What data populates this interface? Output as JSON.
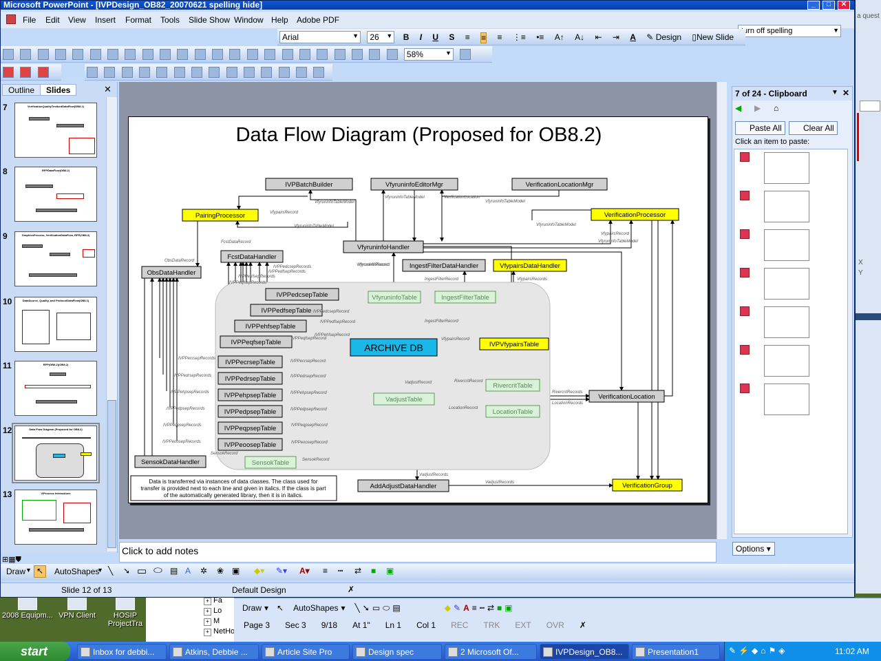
{
  "window": {
    "title": "Microsoft PowerPoint - [IVPDesign_OB82_20070621 spelling hide]"
  },
  "menu": [
    "File",
    "Edit",
    "View",
    "Insert",
    "Format",
    "Tools",
    "Slide Show",
    "Window",
    "Help",
    "Adobe PDF"
  ],
  "ask": "turn off spelling",
  "formatting": {
    "font": "Arial",
    "size": "26",
    "design_label": "Design",
    "newslide_label": "New Slide"
  },
  "standard": {
    "zoom": "58%"
  },
  "left_pane": {
    "tab_outline": "Outline",
    "tab_slides": "Slides",
    "slides": [
      {
        "num": "7",
        "title": "VerificationQualityTestbedDataFlow(OB8.1)"
      },
      {
        "num": "8",
        "title": "RFPDataFlow(OB8.2)"
      },
      {
        "num": "9",
        "title": "GraphicsProcess, VerificationDataFlow, RFP(OB8.2)"
      },
      {
        "num": "10",
        "title": "DataSource, Quality, and ProtocolDataFlow(OB8.1)"
      },
      {
        "num": "11",
        "title": "RFP(OB8.2)(OB8.2)"
      },
      {
        "num": "12",
        "title": "Data Flow Diagram (Proposed for OB8.2)",
        "selected": true
      },
      {
        "num": "13",
        "title": "VIProcess Interactions"
      }
    ]
  },
  "slide": {
    "title": "Data Flow Diagram (Proposed for OB8.2)",
    "note": [
      "Data is transferred via instances of data classes.  The class used for",
      "transfer is provided next to each line and given in italics.  If the class is part",
      "of the automatically generated library, then it is in italics."
    ],
    "db": "ARCHIVE DB",
    "boxes": [
      {
        "label": "IVPBatchBuilder",
        "style": "gray"
      },
      {
        "label": "VfyruninfoEditorMgr",
        "style": "gray"
      },
      {
        "label": "VerificationLocationMgr",
        "style": "gray"
      },
      {
        "label": "PairingProcessor",
        "style": "yellow"
      },
      {
        "label": "VerificationProcessor",
        "style": "yellow"
      },
      {
        "label": "VfyruninfoHandler",
        "style": "gray"
      },
      {
        "label": "FcstDataHandler",
        "style": "gray"
      },
      {
        "label": "ObsDataHandler",
        "style": "gray"
      },
      {
        "label": "IngestFilterDataHandler",
        "style": "gray"
      },
      {
        "label": "VfypairsDataHandler",
        "style": "yellow"
      },
      {
        "label": "VfyruninfoTable",
        "style": "green"
      },
      {
        "label": "IngestFilterTable",
        "style": "green"
      },
      {
        "label": "IVPPedcsepTable",
        "style": "gray"
      },
      {
        "label": "IVPPedfsepTable",
        "style": "gray"
      },
      {
        "label": "IVPPehfsepTable",
        "style": "gray"
      },
      {
        "label": "IVPPeqfsepTable",
        "style": "gray"
      },
      {
        "label": "IVPVfypairsTable",
        "style": "yellow"
      },
      {
        "label": "IVPPecrsepTable",
        "style": "gray"
      },
      {
        "label": "IVPPedrsepTable",
        "style": "gray"
      },
      {
        "label": "IVPPehpsepTable",
        "style": "gray"
      },
      {
        "label": "IVPPedpsepTable",
        "style": "gray"
      },
      {
        "label": "IVPPeqpsepTable",
        "style": "gray"
      },
      {
        "label": "IVPPeoosepTable",
        "style": "gray"
      },
      {
        "label": "VadjustTable",
        "style": "green"
      },
      {
        "label": "RivercritTable",
        "style": "green"
      },
      {
        "label": "LocationTable",
        "style": "green"
      },
      {
        "label": "VerificationLocation",
        "style": "gray"
      },
      {
        "label": "SensokDataHandler",
        "style": "gray"
      },
      {
        "label": "SensokTable",
        "style": "green"
      },
      {
        "label": "AddAdjustDataHandler",
        "style": "gray"
      },
      {
        "label": "VerificationGroup",
        "style": "yellow"
      }
    ],
    "edge_labels": [
      "VfyruninfoTableModel",
      "VfyruninfoTableModel",
      "VerificationLocation",
      "VfyruninfoTableModel",
      "VfypairsRecord",
      "VfyruninfoTableModel",
      "VfyruninfoTableModel",
      "VfypairsRecord",
      "VfyruninfoTableModel",
      "FcstDataRecord",
      "ObsDataRecord",
      "IVPPedcsepRecords",
      "IVPPedfsepRecords",
      "IVPPehfsepRecords",
      "IVPPeqfsepRecords",
      "VfyruninfoRecord",
      "IngestFilterRecord",
      "VfypairsRecords",
      "IVPPedcsepRecord",
      "IVPPedfsepRecord",
      "IVPPehfsepRecord",
      "IVPPeqfsepRecord",
      "IngestFilterRecord",
      "VfypairsRecord",
      "IVPPecrsepRecords",
      "IVPPedrsepRecords",
      "IVPPehpsepRecords",
      "IVPPedpsepRecords",
      "IVPPeqpsepRecords",
      "IVPPeoosepRecords",
      "IVPPecrsepRecord",
      "IVPPedrsepRecord",
      "IVPPehpsepRecord",
      "IVPPedpsepRecord",
      "IVPPeqpsepRecord",
      "IVPPeoosepRecord",
      "VadjustRecord",
      "RivercritRecord",
      "LocationRecord",
      "RivercritRecords",
      "LocationRecords",
      "SensokRecord",
      "SensokRecord",
      "VadjustRecords",
      "VadjustRecords",
      "VfyruninfoRecord"
    ]
  },
  "notes_placeholder": "Click to add notes",
  "clipboard": {
    "title": "7 of 24 - Clipboard",
    "paste_all": "Paste All",
    "clear_all": "Clear All",
    "hint": "Click an item to paste:",
    "options": "Options"
  },
  "draw_toolbar": {
    "draw": "Draw",
    "autoshapes": "AutoShapes"
  },
  "status": {
    "slide": "Slide 12 of 13",
    "design": "Default Design"
  },
  "desktop": {
    "icons": [
      "2008 Equipm...",
      "VPN Client",
      "HOSIP ProjectTra"
    ],
    "explorer": [
      "Fa",
      "Lo",
      "M",
      "NetHood"
    ]
  },
  "word": {
    "draw": "Draw",
    "autoshapes": "AutoShapes",
    "page": "Page  3",
    "sec": "Sec  3",
    "pos": "9/18",
    "at": "At  1\"",
    "ln": "Ln  1",
    "col": "Col  1",
    "modes": [
      "REC",
      "TRK",
      "EXT",
      "OVR"
    ]
  },
  "taskbar": {
    "start": "start",
    "tasks": [
      "Inbox for debbi...",
      "Atkins, Debbie ...",
      "Article Site Pro",
      "Design spec",
      "2 Microsoft Of...",
      "IVPDesign_OB8...",
      "Presentation1"
    ],
    "time": "11:02 AM"
  },
  "right_strip": {
    "text": "a quest"
  }
}
